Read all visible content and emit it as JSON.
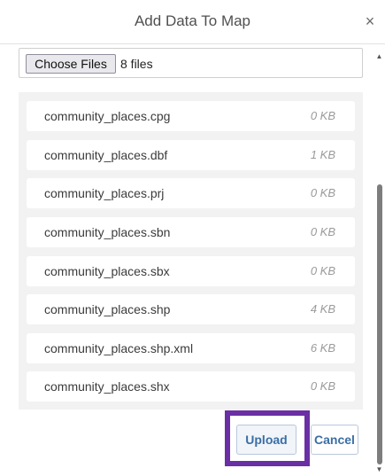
{
  "dialog": {
    "title": "Add Data To Map",
    "close_icon": "close-icon",
    "close_glyph": "×"
  },
  "file_input": {
    "button_label": "Choose Files",
    "status": "8 files"
  },
  "files": [
    {
      "name": "community_places.cpg",
      "size": "0 KB"
    },
    {
      "name": "community_places.dbf",
      "size": "1 KB"
    },
    {
      "name": "community_places.prj",
      "size": "0 KB"
    },
    {
      "name": "community_places.sbn",
      "size": "0 KB"
    },
    {
      "name": "community_places.sbx",
      "size": "0 KB"
    },
    {
      "name": "community_places.shp",
      "size": "4 KB"
    },
    {
      "name": "community_places.shp.xml",
      "size": "6 KB"
    },
    {
      "name": "community_places.shx",
      "size": "0 KB"
    }
  ],
  "actions": {
    "upload_label": "Upload",
    "cancel_label": "Cancel"
  },
  "colors": {
    "highlight": "#6a2fa4",
    "action_text": "#3a6ea5",
    "list_panel": "#f2f2f2"
  }
}
